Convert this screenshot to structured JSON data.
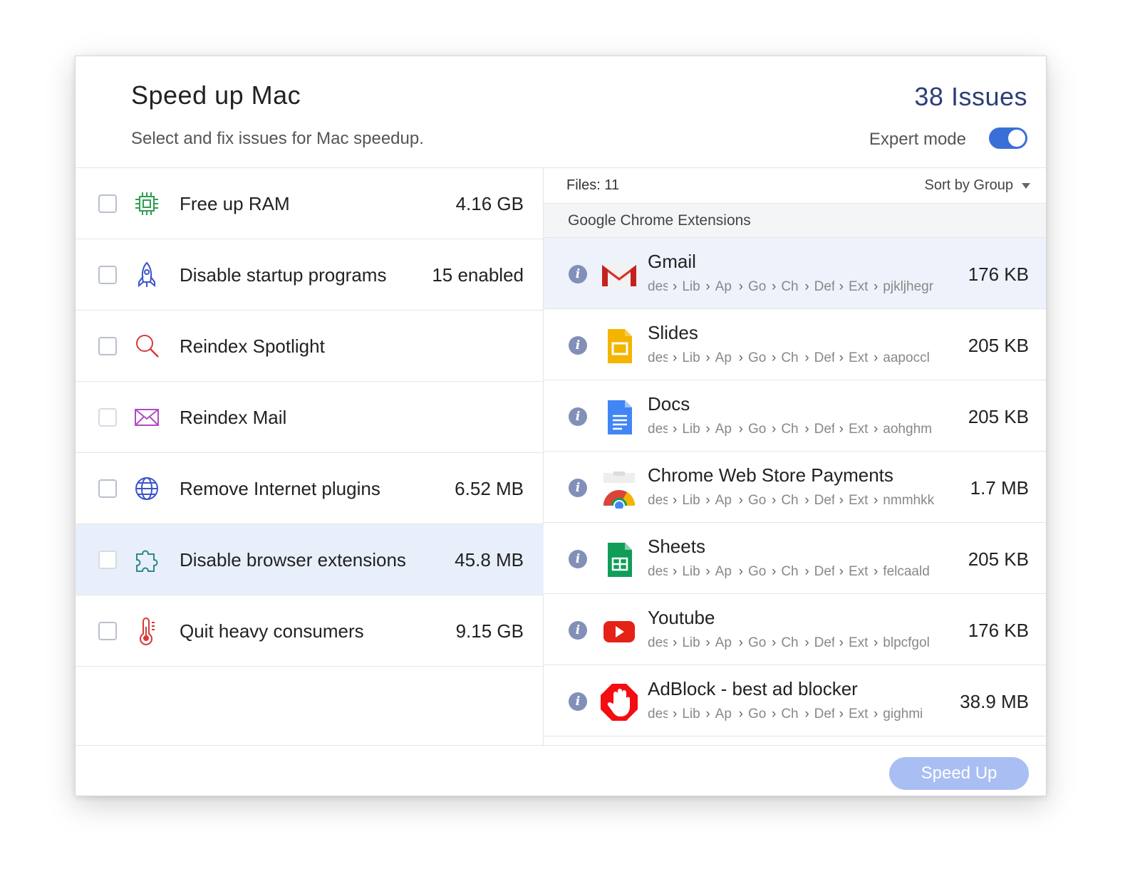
{
  "header": {
    "title": "Speed up Mac",
    "subtitle": "Select and fix issues for Mac speedup.",
    "issues": "38 Issues",
    "expert_mode_label": "Expert mode",
    "expert_mode_on": true
  },
  "left": {
    "items": [
      {
        "label": "Free up RAM",
        "value": "4.16 GB",
        "icon": "chip-icon",
        "checked": false
      },
      {
        "label": "Disable startup programs",
        "value": "15 enabled",
        "icon": "rocket-icon",
        "checked": false
      },
      {
        "label": "Reindex Spotlight",
        "value": "",
        "icon": "magnifier-icon",
        "checked": false
      },
      {
        "label": "Reindex Mail",
        "value": "",
        "icon": "envelope-icon",
        "checked": false
      },
      {
        "label": "Remove Internet plugins",
        "value": "6.52 MB",
        "icon": "globe-icon",
        "checked": false
      },
      {
        "label": "Disable browser extensions",
        "value": "45.8 MB",
        "icon": "puzzle-icon",
        "checked": false,
        "selected": true
      },
      {
        "label": "Quit heavy consumers",
        "value": "9.15 GB",
        "icon": "thermometer-icon",
        "checked": false
      }
    ]
  },
  "right": {
    "files_label": "Files: 11",
    "sort_label": "Sort by Group",
    "group_label": "Google Chrome Extensions",
    "path_segments": [
      "des",
      "Lib",
      "Ap",
      "Go",
      "Chr",
      "Def",
      "Ext"
    ],
    "items": [
      {
        "name": "Gmail",
        "size": "176 KB",
        "path_tail": "pjkljhegr",
        "icon": "gmail-icon"
      },
      {
        "name": "Slides",
        "size": "205 KB",
        "path_tail": "aapoccl",
        "icon": "slides-icon"
      },
      {
        "name": "Docs",
        "size": "205 KB",
        "path_tail": "aohghm",
        "icon": "docs-icon"
      },
      {
        "name": "Chrome Web Store Payments",
        "size": "1.7 MB",
        "path_tail": "nmmhkk",
        "icon": "chrome-webstore-icon"
      },
      {
        "name": "Sheets",
        "size": "205 KB",
        "path_tail": "felcaald",
        "icon": "sheets-icon"
      },
      {
        "name": "Youtube",
        "size": "176 KB",
        "path_tail": "blpcfgol",
        "icon": "youtube-icon"
      },
      {
        "name": "AdBlock - best ad blocker",
        "size": "38.9 MB",
        "path_tail": "gighmi",
        "icon": "adblock-icon"
      }
    ]
  },
  "footer": {
    "speed_up_label": "Speed Up"
  },
  "colors": {
    "accent": "#3a6fd8",
    "issues_text": "#2c3e78",
    "button_disabled": "#a9bff3",
    "selected_row": "#e9effa"
  }
}
